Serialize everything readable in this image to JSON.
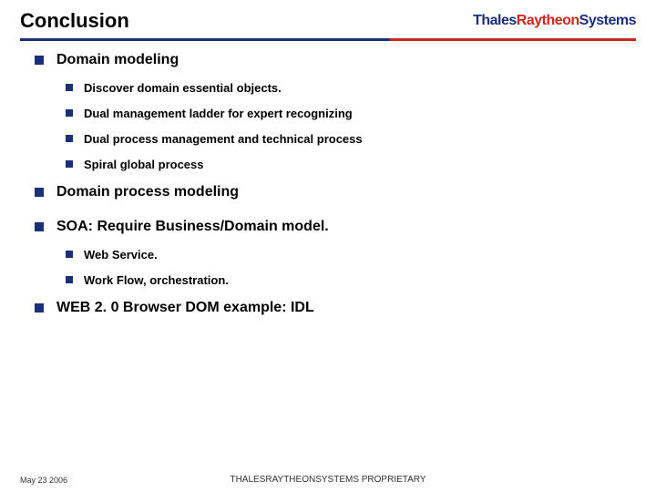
{
  "title": "Conclusion",
  "logo": {
    "part1": "Thales",
    "part2": "Raytheon",
    "part3": "Systems"
  },
  "bullets": {
    "b1": "Domain modeling",
    "b1_1": "Discover domain essential objects.",
    "b1_2": "Dual management ladder for expert recognizing",
    "b1_3": "Dual process management and technical process",
    "b1_4": "Spiral global process",
    "b2": "Domain process modeling",
    "b3": "SOA: Require Business/Domain model.",
    "b3_1": "Web Service.",
    "b3_2": "Work Flow, orchestration.",
    "b4": "WEB 2. 0 Browser DOM example: IDL"
  },
  "footer": {
    "date": "May 23 2006",
    "center": "THALESRAYTHEONSYSTEMS PROPRIETARY"
  }
}
